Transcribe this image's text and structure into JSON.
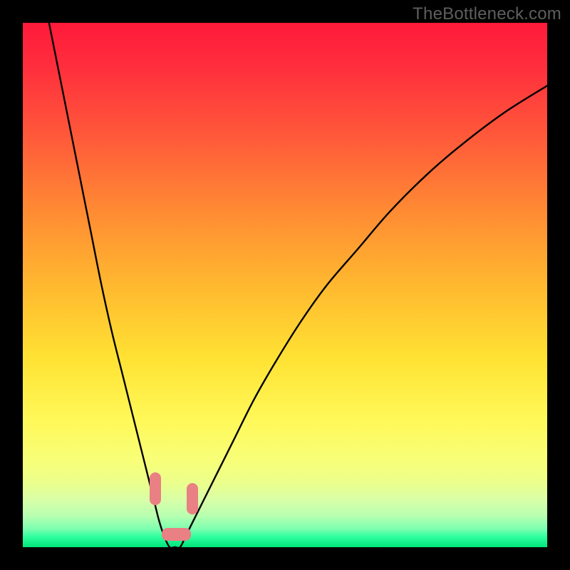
{
  "attribution": "TheBottleneck.com",
  "chart_data": {
    "type": "line",
    "title": "",
    "xlabel": "",
    "ylabel": "",
    "xlim": [
      0,
      100
    ],
    "ylim": [
      0,
      100
    ],
    "series": [
      {
        "name": "bottleneck-curve",
        "x": [
          5,
          7,
          9,
          11,
          13,
          15,
          17,
          19,
          21,
          23,
          24,
          25,
          26,
          27,
          28,
          29,
          30,
          31,
          32,
          34,
          37,
          40,
          44,
          48,
          53,
          58,
          64,
          70,
          77,
          84,
          92,
          100
        ],
        "values": [
          100,
          90,
          80,
          70,
          60,
          50,
          41,
          33,
          25,
          17,
          13,
          9,
          5,
          2,
          0,
          0,
          0,
          2,
          4,
          8,
          14,
          20,
          28,
          35,
          43,
          50,
          57,
          64,
          71,
          77,
          83,
          88
        ]
      }
    ],
    "markers": [
      {
        "name": "blob-left",
        "x": 24.2,
        "y": 8.0,
        "w": 2.2,
        "h": 6.2
      },
      {
        "name": "blob-bottom",
        "x": 26.5,
        "y": 1.2,
        "w": 5.5,
        "h": 2.5
      },
      {
        "name": "blob-right",
        "x": 31.2,
        "y": 6.2,
        "w": 2.2,
        "h": 6.0
      }
    ],
    "background": {
      "type": "vertical-gradient",
      "stops": [
        {
          "pos": 0,
          "color": "#ff1a3a"
        },
        {
          "pos": 0.5,
          "color": "#ffb82f"
        },
        {
          "pos": 0.8,
          "color": "#fff95a"
        },
        {
          "pos": 1.0,
          "color": "#00e57a"
        }
      ]
    }
  }
}
